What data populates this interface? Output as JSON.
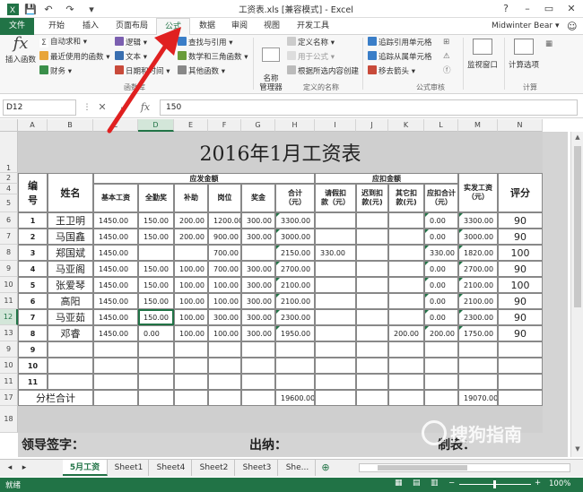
{
  "window": {
    "title": "工资表.xls [兼容模式] - Excel",
    "min": "–",
    "restore": "▭",
    "close": "✕",
    "help": "?"
  },
  "qat": {
    "save": "💾",
    "undo": "↶",
    "redo": "↷",
    "customize": "▾"
  },
  "ribbon_tabs": [
    "文件",
    "开始",
    "插入",
    "页面布局",
    "公式",
    "数据",
    "审阅",
    "视图",
    "开发工具"
  ],
  "active_tab": "公式",
  "user": "Midwinter Bear ▾",
  "ribbon": {
    "insert_function": "插入函数",
    "autosum": "自动求和 ▾",
    "recent": "最近使用的函数 ▾",
    "financial": "财务 ▾",
    "logical": "逻辑 ▾",
    "text": "文本 ▾",
    "datetime": "日期和时间 ▾",
    "lookup": "查找与引用 ▾",
    "math": "数学和三角函数 ▾",
    "more": "其他函数 ▾",
    "group_library": "函数库",
    "name_manager": "名称\n管理器",
    "define_name": "定义名称 ▾",
    "use_in_formula": "用于公式 ▾",
    "create_from_sel": "根据所选内容创建",
    "group_names": "定义的名称",
    "trace_prec": "追踪引用单元格",
    "trace_dep": "追踪从属单元格",
    "remove_arrows": "移去箭头 ▾",
    "group_audit": "公式审核",
    "watch": "监视窗口",
    "calc_options": "计算选项",
    "group_calc": "计算"
  },
  "formula_bar": {
    "name_box": "D12",
    "value": "150",
    "fx": "fx",
    "cancel": "✕",
    "enter": "✓"
  },
  "columns": [
    "A",
    "B",
    "C",
    "D",
    "E",
    "F",
    "G",
    "H",
    "I",
    "J",
    "K",
    "L",
    "M",
    "N"
  ],
  "selected_column": "D",
  "selected_row": "12",
  "rows": [
    "1",
    "2",
    "4",
    "5",
    "6",
    "7",
    "8",
    "9",
    "10",
    "11",
    "12",
    "13",
    "9",
    "10",
    "11",
    "17",
    "18"
  ],
  "sheet": {
    "title": "2016年1月工资表",
    "h_no": "编\n号",
    "h_name": "姓名",
    "h_should": "应发金额",
    "h_deduct": "应扣金额",
    "h_base": "基本工资",
    "h_attend": "全勤奖",
    "h_subsidy": "补助",
    "h_post": "岗位",
    "h_bonus": "奖金",
    "h_total": "合计\n（元）",
    "h_leave": "请假扣\n款（元）",
    "h_late": "迟到扣\n款(元)",
    "h_other": "其它扣\n款(元)",
    "h_dtotal": "应扣合计\n（元）",
    "h_actual": "实发工资\n（元）",
    "h_score": "评分",
    "data": [
      [
        "1",
        "王卫明",
        "1450.00",
        "150.00",
        "200.00",
        "1200.00",
        "300.00",
        "3300.00",
        "",
        "",
        "",
        "0.00",
        "3300.00",
        "90"
      ],
      [
        "2",
        "马国鑫",
        "1450.00",
        "150.00",
        "200.00",
        "900.00",
        "300.00",
        "3000.00",
        "",
        "",
        "",
        "0.00",
        "3000.00",
        "90"
      ],
      [
        "3",
        "郑国斌",
        "1450.00",
        "",
        "",
        "700.00",
        "",
        "2150.00",
        "330.00",
        "",
        "",
        "330.00",
        "1820.00",
        "100"
      ],
      [
        "4",
        "马亚阁",
        "1450.00",
        "150.00",
        "100.00",
        "700.00",
        "300.00",
        "2700.00",
        "",
        "",
        "",
        "0.00",
        "2700.00",
        "90"
      ],
      [
        "5",
        "张爱琴",
        "1450.00",
        "150.00",
        "100.00",
        "100.00",
        "300.00",
        "2100.00",
        "",
        "",
        "",
        "0.00",
        "2100.00",
        "100"
      ],
      [
        "6",
        "高阳",
        "1450.00",
        "150.00",
        "100.00",
        "100.00",
        "300.00",
        "2100.00",
        "",
        "",
        "",
        "0.00",
        "2100.00",
        "90"
      ],
      [
        "7",
        "马亚茹",
        "1450.00",
        "150.00",
        "100.00",
        "300.00",
        "300.00",
        "2300.00",
        "",
        "",
        "",
        "0.00",
        "2300.00",
        "90"
      ],
      [
        "8",
        "邓睿",
        "1450.00",
        "0.00",
        "100.00",
        "100.00",
        "300.00",
        "1950.00",
        "",
        "",
        "200.00",
        "200.00",
        "1750.00",
        "90"
      ],
      [
        "9",
        "",
        "",
        "",
        "",
        "",
        "",
        "",
        "",
        "",
        "",
        "",
        "",
        ""
      ],
      [
        "10",
        "",
        "",
        "",
        "",
        "",
        "",
        "",
        "",
        "",
        "",
        "",
        "",
        ""
      ],
      [
        "11",
        "",
        "",
        "",
        "",
        "",
        "",
        "",
        "",
        "",
        "",
        "",
        "",
        ""
      ]
    ],
    "subtotal_label": "分栏合计",
    "subtotal_total": "19600.00",
    "subtotal_actual": "19070.00",
    "sign_leader": "领导签字：",
    "sign_cashier": "出纳：",
    "sign_maker": "制表："
  },
  "sheet_tabs": [
    "5月工资",
    "Sheet1",
    "Sheet4",
    "Sheet2",
    "Sheet3",
    "She..."
  ],
  "active_sheet": "5月工资",
  "status": {
    "ready": "就绪",
    "zoom": "100%"
  },
  "watermark": "搜狗指南",
  "colors": {
    "accent": "#217346",
    "arrow": "#e02020"
  }
}
